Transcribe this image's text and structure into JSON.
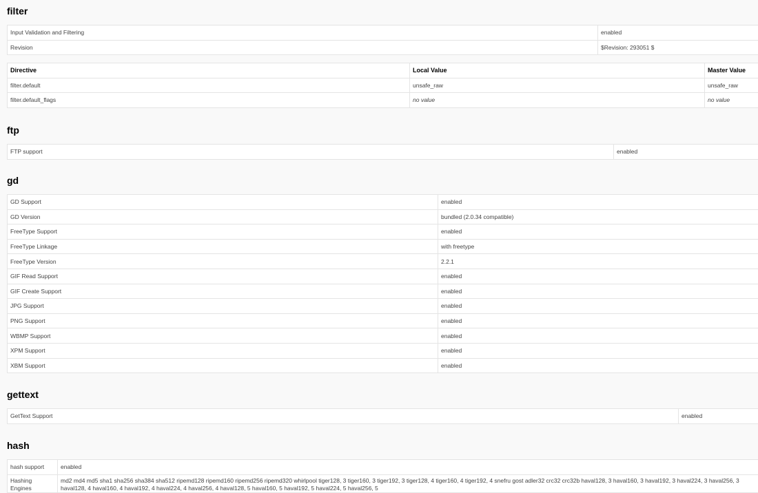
{
  "filter": {
    "title": "filter",
    "info_rows": [
      {
        "key": "Input Validation and Filtering",
        "value": "enabled"
      },
      {
        "key": "Revision",
        "value": "$Revision: 293051 $"
      }
    ],
    "directive_headers": {
      "directive": "Directive",
      "local": "Local Value",
      "master": "Master Value"
    },
    "directives": [
      {
        "name": "filter.default",
        "local": "unsafe_raw",
        "master": "unsafe_raw"
      },
      {
        "name": "filter.default_flags",
        "local": "no value",
        "master": "no value"
      }
    ]
  },
  "ftp": {
    "title": "ftp",
    "rows": [
      {
        "key": "FTP support",
        "value": "enabled"
      }
    ]
  },
  "gd": {
    "title": "gd",
    "rows": [
      {
        "key": "GD Support",
        "value": "enabled"
      },
      {
        "key": "GD Version",
        "value": "bundled (2.0.34 compatible)"
      },
      {
        "key": "FreeType Support",
        "value": "enabled"
      },
      {
        "key": "FreeType Linkage",
        "value": "with freetype"
      },
      {
        "key": "FreeType Version",
        "value": "2.2.1"
      },
      {
        "key": "GIF Read Support",
        "value": "enabled"
      },
      {
        "key": "GIF Create Support",
        "value": "enabled"
      },
      {
        "key": "JPG Support",
        "value": "enabled"
      },
      {
        "key": "PNG Support",
        "value": "enabled"
      },
      {
        "key": "WBMP Support",
        "value": "enabled"
      },
      {
        "key": "XPM Support",
        "value": "enabled"
      },
      {
        "key": "XBM Support",
        "value": "enabled"
      }
    ]
  },
  "gettext": {
    "title": "gettext",
    "rows": [
      {
        "key": "GetText Support",
        "value": "enabled"
      }
    ]
  },
  "hash": {
    "title": "hash",
    "rows": [
      {
        "key": "hash support",
        "value": "enabled"
      },
      {
        "key": "Hashing Engines",
        "value": "md2 md4 md5 sha1 sha256 sha384 sha512 ripemd128 ripemd160 ripemd256 ripemd320 whirlpool tiger128, 3 tiger160, 3 tiger192, 3 tiger128, 4 tiger160, 4 tiger192, 4 snefru gost adler32 crc32 crc32b haval128, 3 haval160, 3 haval192, 3 haval224, 3 haval256, 3 haval128, 4 haval160, 4 haval192, 4 haval224, 4 haval256, 4 haval128, 5 haval160, 5 haval192, 5 haval224, 5 haval256, 5"
      }
    ]
  }
}
